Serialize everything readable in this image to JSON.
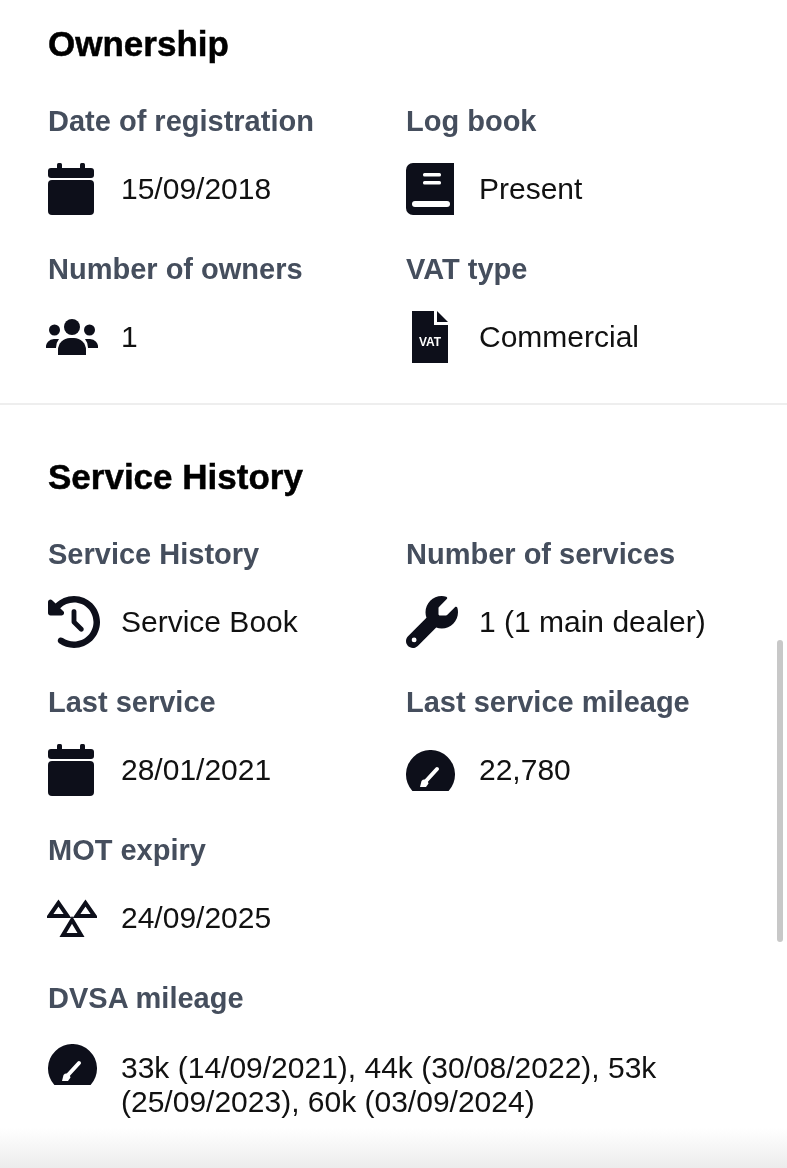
{
  "sections": [
    {
      "title": "Ownership",
      "fields": [
        {
          "label": "Date of registration",
          "value": "15/09/2018",
          "kind": "calendar"
        },
        {
          "label": "Log book",
          "value": "Present",
          "kind": "book"
        },
        {
          "label": "Number of owners",
          "value": "1",
          "kind": "people"
        },
        {
          "label": "VAT type",
          "value": "Commercial",
          "kind": "document",
          "icon_text": "VAT"
        }
      ]
    },
    {
      "title": "Service History",
      "fields": [
        {
          "label": "Service History",
          "value": "Service Book",
          "kind": "history"
        },
        {
          "label": "Number of services",
          "value": "1 (1 main dealer)",
          "kind": "wrench"
        },
        {
          "label": "Last service",
          "value": "28/01/2021",
          "kind": "calendar"
        },
        {
          "label": "Last service mileage",
          "value": "22,780",
          "kind": "gauge"
        },
        {
          "label": "MOT expiry",
          "value": "24/09/2025",
          "kind": "mot"
        },
        {
          "label": "DVSA mileage",
          "value": "33k (14/09/2021), 44k (30/08/2022), 53k (25/09/2023), 60k (03/09/2024)",
          "kind": "gauge",
          "wide": true
        }
      ]
    }
  ]
}
